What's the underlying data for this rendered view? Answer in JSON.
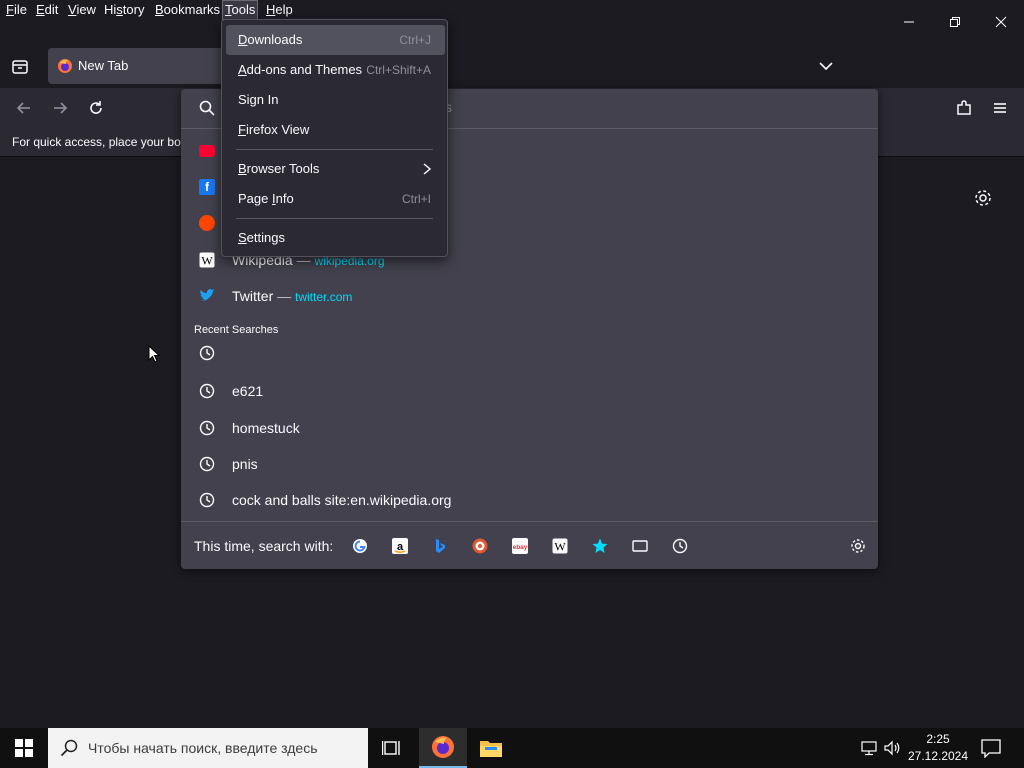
{
  "menubar": {
    "file": {
      "pre": "",
      "u": "F",
      "post": "ile"
    },
    "edit": {
      "pre": "",
      "u": "E",
      "post": "dit"
    },
    "view": {
      "pre": "",
      "u": "V",
      "post": "iew"
    },
    "history": {
      "pre": "Hi",
      "u": "s",
      "post": "tory"
    },
    "bookmarks": {
      "pre": "",
      "u": "B",
      "post": "ookmarks"
    },
    "tools": {
      "pre": "",
      "u": "T",
      "post": "ools"
    },
    "help": {
      "pre": "",
      "u": "H",
      "post": "elp"
    }
  },
  "tab": {
    "title": "New Tab"
  },
  "bookmarks_bar": {
    "hint": "For quick access, place your boo"
  },
  "url_panel": {
    "search_hint": "s",
    "shortcuts": [
      {
        "name": "Wikipedia",
        "dash": "—",
        "url": "wikipedia.org",
        "icon": "wikipedia-icon"
      },
      {
        "name": "Twitter",
        "dash": "—",
        "url": "twitter.com",
        "icon": "twitter-icon"
      }
    ],
    "recent_heading": "Recent Searches",
    "recent": [
      "",
      "e621",
      "homestuck",
      "pnis",
      "cock and balls site:en.wikipedia.org"
    ],
    "oneoff_label": "This time, search with:"
  },
  "tools_menu": {
    "items": [
      {
        "label": "Downloads",
        "underline": "D",
        "rest": "ownloads",
        "pre": "",
        "shortcut": "Ctrl+J"
      },
      {
        "label": "Add-ons and Themes",
        "pre": "",
        "underline": "A",
        "rest": "dd-ons and Themes",
        "shortcut": "Ctrl+Shift+A"
      },
      {
        "label": "Sign In",
        "pre": "Sign In",
        "underline": "",
        "rest": "",
        "shortcut": ""
      },
      {
        "label": "Firefox View",
        "pre": "",
        "underline": "F",
        "rest": "irefox View",
        "shortcut": ""
      },
      {
        "label": "Browser Tools",
        "pre": "",
        "underline": "B",
        "rest": "rowser Tools",
        "shortcut": ""
      },
      {
        "label": "Page Info",
        "pre": "Page ",
        "underline": "I",
        "rest": "nfo",
        "shortcut": "Ctrl+I"
      },
      {
        "label": "Settings",
        "pre": "",
        "underline": "S",
        "rest": "ettings",
        "shortcut": ""
      }
    ]
  },
  "taskbar": {
    "search_placeholder": "Чтобы начать поиск, введите здесь",
    "time": "2:25",
    "date": "27.12.2024"
  },
  "colors": {
    "accent": "#00ddff",
    "panel": "#42414d",
    "menu": "#2b2a33",
    "background": "#1c1b22"
  }
}
